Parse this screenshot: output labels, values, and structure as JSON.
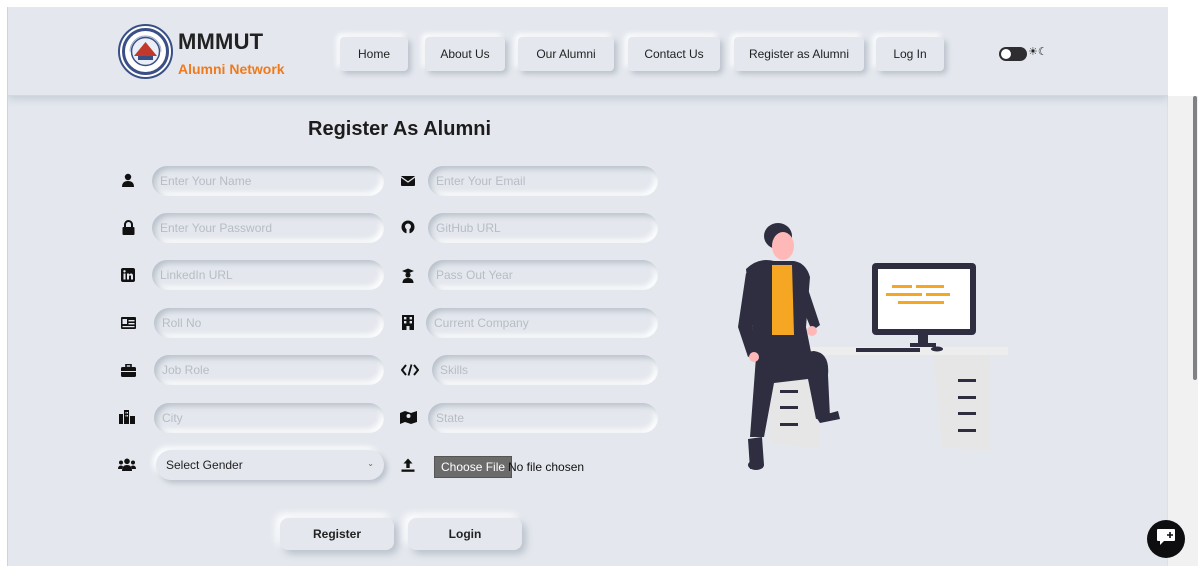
{
  "header": {
    "logo_title": "MMMUT",
    "logo_subtitle": "Alumni Network",
    "nav": [
      "Home",
      "About Us",
      "Our Alumni",
      "Contact Us",
      "Register as Alumni",
      "Log In"
    ],
    "theme_toggle_icons": "☀☾"
  },
  "form": {
    "title": "Register As Alumni",
    "placeholders": {
      "name": "Enter Your Name",
      "email": "Enter Your Email",
      "password": "Enter Your Password",
      "github": "GitHub URL",
      "linkedin": "LinkedIn URL",
      "pass_out_year": "Pass Out Year",
      "roll_no": "Roll No",
      "current_company": "Current Company",
      "job_role": "Job Role",
      "skills": "Skills",
      "city": "City",
      "state": "State"
    },
    "gender_selected": "Select Gender",
    "choose_file_label": "Choose File",
    "no_file_text": "No file chosen",
    "register_label": "Register",
    "login_label": "Login"
  },
  "colors": {
    "background": "#e4e8ee",
    "accent_orange": "#f07a1b",
    "illustration_yellow": "#f5a623",
    "dark": "#2f2e41"
  },
  "icons": {
    "name": "user-icon",
    "email": "envelope-icon",
    "password": "lock-icon",
    "github": "github-icon",
    "linkedin": "linkedin-icon",
    "pass_out_year": "graduation-icon",
    "roll_no": "id-card-icon",
    "current_company": "building-icon",
    "job_role": "briefcase-icon",
    "skills": "code-icon",
    "city": "city-icon",
    "state": "map-icon",
    "gender": "users-icon",
    "upload": "upload-icon",
    "chat": "chat-icon"
  }
}
